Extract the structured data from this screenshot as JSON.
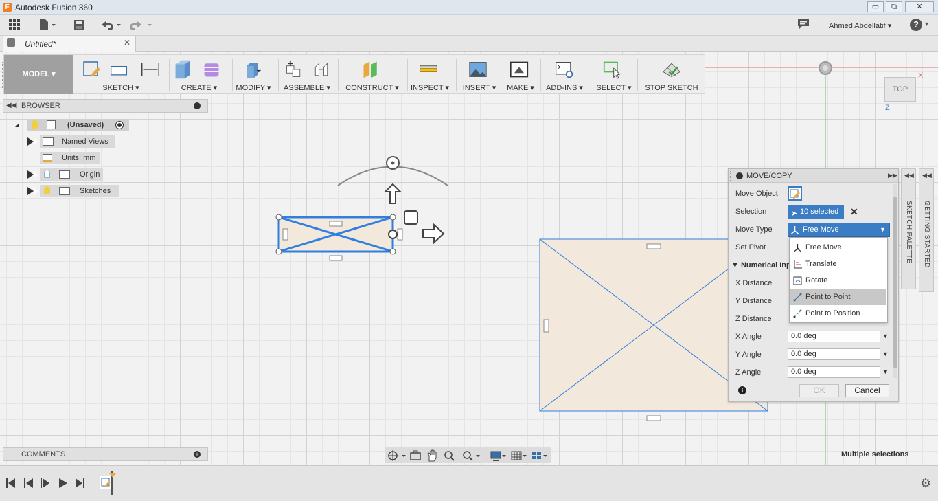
{
  "window": {
    "title": "Autodesk Fusion 360",
    "logo_letter": "F",
    "minimize": "▭",
    "restore": "⧉",
    "close": "✕"
  },
  "user": {
    "name": "Ahmed Abdellatif",
    "help": "?"
  },
  "document": {
    "tab_title": "Untitled*",
    "close": "✕"
  },
  "workspace": {
    "label": "MODEL"
  },
  "toolbar": {
    "sketch": "SKETCH",
    "create": "CREATE",
    "modify": "MODIFY",
    "assemble": "ASSEMBLE",
    "construct": "CONSTRUCT",
    "inspect": "INSPECT",
    "insert": "INSERT",
    "make": "MAKE",
    "addins": "ADD-INS",
    "select": "SELECT",
    "stop_sketch": "STOP SKETCH"
  },
  "browser": {
    "title": "BROWSER",
    "root": "(Unsaved)",
    "items": [
      "Named Views",
      "Units: mm",
      "Origin",
      "Sketches"
    ]
  },
  "comments": {
    "title": "COMMENTS"
  },
  "viewcube": {
    "face": "TOP",
    "axis_x": "X",
    "axis_z": "Z"
  },
  "dialog": {
    "title": "MOVE/COPY",
    "move_object_label": "Move Object",
    "selection_label": "Selection",
    "selection_value": "10 selected",
    "move_type_label": "Move Type",
    "move_type_value": "Free Move",
    "set_pivot_label": "Set Pivot",
    "numerical_input_label": "Numerical Inp",
    "x_distance_label": "X Distance",
    "y_distance_label": "Y Distance",
    "z_distance_label": "Z Distance",
    "x_angle_label": "X Angle",
    "x_angle_value": "0.0 deg",
    "y_angle_label": "Y Angle",
    "y_angle_value": "0.0 deg",
    "z_angle_label": "Z Angle",
    "z_angle_value": "0.0 deg",
    "info": "i",
    "ok": "OK",
    "cancel": "Cancel",
    "move_type_options": [
      "Free Move",
      "Translate",
      "Rotate",
      "Point to Point",
      "Point to Position"
    ],
    "highlighted_option": "Point to Point"
  },
  "side_panels": {
    "sketch_palette": "SKETCH PALETTE",
    "getting_started": "GETTING STARTED"
  },
  "status": {
    "text": "Multiple selections"
  },
  "colors": {
    "selection_blue": "#2f7fe0",
    "sketch_fill": "#f3e8dc",
    "dropdown_highlight": "#c8c8c8",
    "field_blue": "#3b7dc4"
  }
}
